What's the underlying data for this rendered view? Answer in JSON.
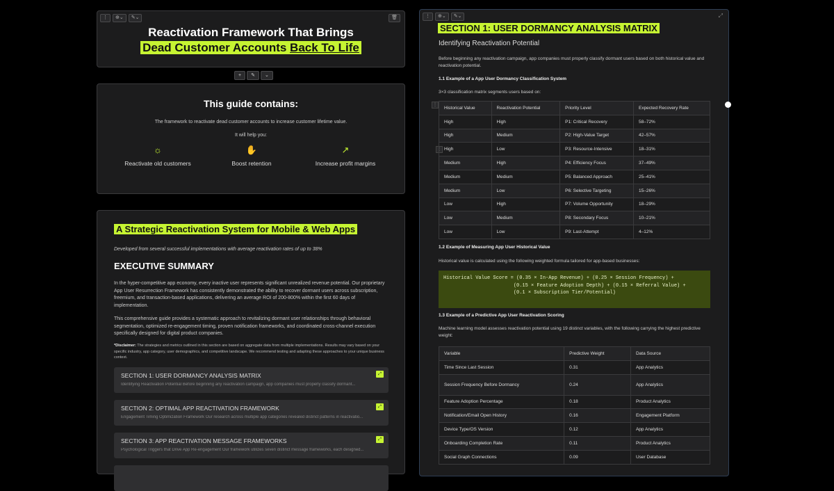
{
  "hero": {
    "title_line1": "Reactivation Framework That Brings",
    "title_hl": "Dead Customer Accounts",
    "title_ul": "Back To Life"
  },
  "toolbar": {
    "handle": "⋮",
    "style": "⊕⌄",
    "ai": "✎⌄",
    "trash": "🗑",
    "add": "+",
    "magic": "✎",
    "more": "⌄",
    "expand": "⤢"
  },
  "guide": {
    "heading": "This guide contains:",
    "line1": "The framework to reactivate dead customer accounts to increase customer lifetime value.",
    "line2": "It will help you:",
    "features": [
      {
        "icon": "bulb-icon",
        "glyph": "☼",
        "label": "Reactivate old customers"
      },
      {
        "icon": "hand-coin-icon",
        "glyph": "✋",
        "label": "Boost retention"
      },
      {
        "icon": "growth-chart-icon",
        "glyph": "↗",
        "label": "Increase profit margins"
      }
    ]
  },
  "strategy": {
    "title": "A Strategic Reactivation System for Mobile & Web Apps",
    "subtitle": "Developed from several successful implementations with average reactivation rates of up to 38%",
    "exec_heading": "EXECUTIVE SUMMARY",
    "para1": "In the hyper-competitive app economy, every inactive user represents significant unrealized revenue potential. Our proprietary App User Resurrection Framework has consistently demonstrated the ability to recover dormant users across subscription, freemium, and transaction-based applications, delivering an average ROI of 200-800% within the first 60 days of implementation.",
    "para2": "This comprehensive guide provides a systematic approach to revitalizing dormant user relationships through behavioral segmentation, optimized re-engagement timing, proven notification frameworks, and coordinated cross-channel execution specifically designed for digital product companies.",
    "disclaimer_label": "*Disclaimer:",
    "disclaimer": " The strategies and metrics outlined in this section are based on aggregate data from multiple implementations. Results may vary based on your specific industry, app category, user demographics, and competitive landscape. We recommend testing and adapting these approaches to your unique business context.",
    "sections": [
      {
        "title": "SECTION 1: USER DORMANCY ANALYSIS MATRIX",
        "desc": "Identifying Reactivation Potential Before beginning any reactivation campaign, app companies must properly classify dormant..."
      },
      {
        "title": "SECTION 2: OPTIMAL APP REACTIVATION FRAMEWORK",
        "desc": "Engagement Timing Optimization Framework Our research across multiple app categories revealed distinct patterns in reactivatio..."
      },
      {
        "title": "SECTION 3: APP REACTIVATION MESSAGE FRAMEWORKS",
        "desc": "Psychological Triggers that Drive App Re-engagement Our framework utilizes seven distinct message frameworks, each designed..."
      }
    ]
  },
  "section1": {
    "title": "SECTION 1: USER DORMANCY ANALYSIS MATRIX",
    "subtitle": "Identifying Reactivation Potential",
    "intro": "Before beginning any reactivation campaign, app companies must properly classify dormant users based on both historical value and reactivation potential.",
    "h11": "1.1 Example of a App User Dormancy Classification System",
    "p11": "3×3 classification matrix segments users based on:",
    "matrix_headers": [
      "Historical Value",
      "Reactivation Potential",
      "Priority Level",
      "Expected Recovery Rate"
    ],
    "matrix_rows": [
      [
        "High",
        "High",
        "P1: Critical Recovery",
        "58–72%"
      ],
      [
        "High",
        "Medium",
        "P2: High-Value Target",
        "42–57%"
      ],
      [
        "High",
        "Low",
        "P3: Resource-Intensive",
        "18–31%"
      ],
      [
        "Medium",
        "High",
        "P4: Efficiency Focus",
        "37–49%"
      ],
      [
        "Medium",
        "Medium",
        "P5: Balanced Approach",
        "25–41%"
      ],
      [
        "Medium",
        "Low",
        "P6: Selective Targeting",
        "15–26%"
      ],
      [
        "Low",
        "High",
        "P7: Volume Opportunity",
        "18–29%"
      ],
      [
        "Low",
        "Medium",
        "P8: Secondary Focus",
        "10–21%"
      ],
      [
        "Low",
        "Low",
        "P9: Last-Attempt",
        "4–12%"
      ]
    ],
    "h12": "1.2  Example of Measuring App User Historical Value",
    "p12": "Historical value is calculated using the following weighted formula tailored for app-based businesses:",
    "formula": "Historical Value Score = (0.35 × In-App Revenue) + (0.25 × Session Frequency) +\n                        (0.15 × Feature Adoption Depth) + (0.15 × Referral Value) +\n                        (0.1 × Subscription Tier/Potential)",
    "h13": "1.3  Example of a Predictive App User Reactivation Scoring",
    "p13": "Machine learning model assesses reactivation potential using 19 distinct variables, with the following carrying the highest predictive weight:",
    "pred_headers": [
      "Variable",
      "Predictive Weight",
      "Data Source"
    ],
    "pred_rows": [
      [
        "Time Since Last Session",
        "0.31",
        "App Analytics"
      ],
      [
        "Session Frequency Before Dormancy",
        "0.24",
        "App Analytics"
      ],
      [
        "Feature Adoption Percentage",
        "0.18",
        "Product Analytics"
      ],
      [
        "Notification/Email Open History",
        "0.16",
        "Engagement Platform"
      ],
      [
        "Device Type/OS Version",
        "0.12",
        "App Analytics"
      ],
      [
        "Onboarding Completion Rate",
        "0.11",
        "Product Analytics"
      ],
      [
        "Social Graph Connections",
        "0.09",
        "User Database"
      ]
    ]
  }
}
